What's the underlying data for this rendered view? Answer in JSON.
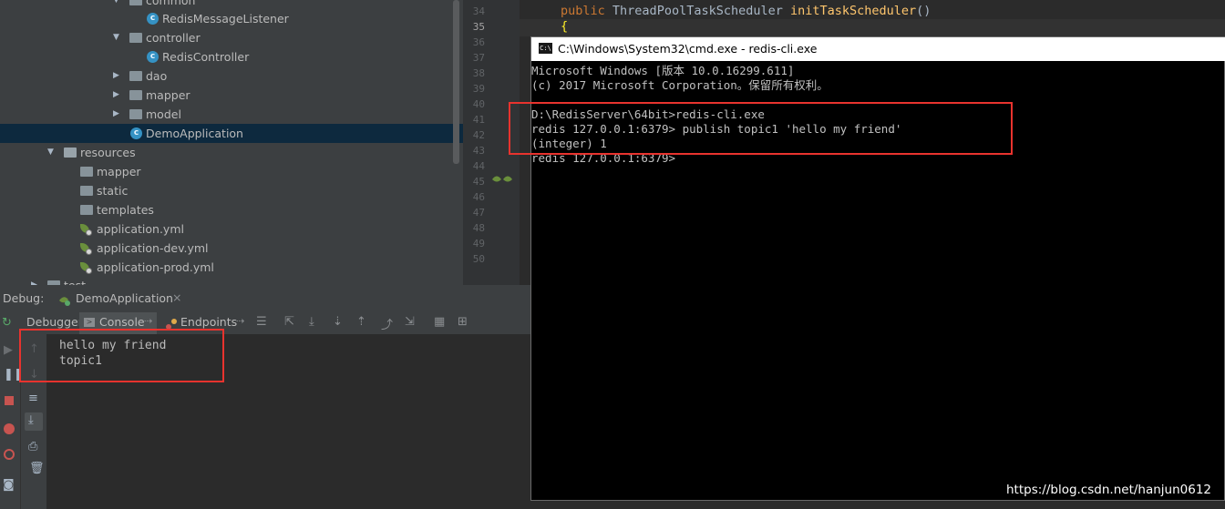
{
  "project_tree": {
    "items": [
      {
        "label": "common",
        "kind": "folder"
      },
      {
        "label": "RedisMessageListener",
        "kind": "class"
      },
      {
        "label": "controller",
        "kind": "folder"
      },
      {
        "label": "RedisController",
        "kind": "class"
      },
      {
        "label": "dao",
        "kind": "folder"
      },
      {
        "label": "mapper",
        "kind": "folder"
      },
      {
        "label": "model",
        "kind": "folder"
      },
      {
        "label": "DemoApplication",
        "kind": "class"
      },
      {
        "label": "resources",
        "kind": "folder"
      },
      {
        "label": "mapper",
        "kind": "folder"
      },
      {
        "label": "static",
        "kind": "folder"
      },
      {
        "label": "templates",
        "kind": "folder"
      },
      {
        "label": "application.yml",
        "kind": "yml"
      },
      {
        "label": "application-dev.yml",
        "kind": "yml"
      },
      {
        "label": "application-prod.yml",
        "kind": "yml"
      },
      {
        "label": "test",
        "kind": "folder"
      }
    ]
  },
  "editor": {
    "line_numbers": [
      "34",
      "35",
      "36",
      "37",
      "38",
      "39",
      "40",
      "41",
      "42",
      "43",
      "44",
      "45",
      "46",
      "47",
      "48",
      "49",
      "50"
    ],
    "current_line": "35",
    "code_line": {
      "kw": "public",
      "type": "ThreadPoolTaskScheduler",
      "fn": "initTaskScheduler",
      "rest": "()"
    },
    "brace": "{"
  },
  "debug": {
    "label": "Debug:",
    "tab": "DemoApplication",
    "close_glyph": "×",
    "tabs": [
      "Debugger",
      "Console",
      "Endpoints"
    ],
    "console_lines": [
      "hello my friend",
      "topic1"
    ]
  },
  "cmd": {
    "title": "C:\\Windows\\System32\\cmd.exe - redis-cli.exe",
    "icon_text": "C:\\",
    "lines": [
      "Microsoft Windows [版本 10.0.16299.611]",
      "(c) 2017 Microsoft Corporation。保留所有权利。",
      "",
      "D:\\RedisServer\\64bit>redis-cli.exe",
      "redis 127.0.0.1:6379> publish topic1 'hello my friend'",
      "(integer) 1",
      "redis 127.0.0.1:6379>"
    ]
  },
  "watermark": "https://blog.csdn.net/hanjun0612",
  "colors": {
    "highlight": "#e8332e",
    "selection": "#0d293e",
    "accent": "#3592c4"
  }
}
